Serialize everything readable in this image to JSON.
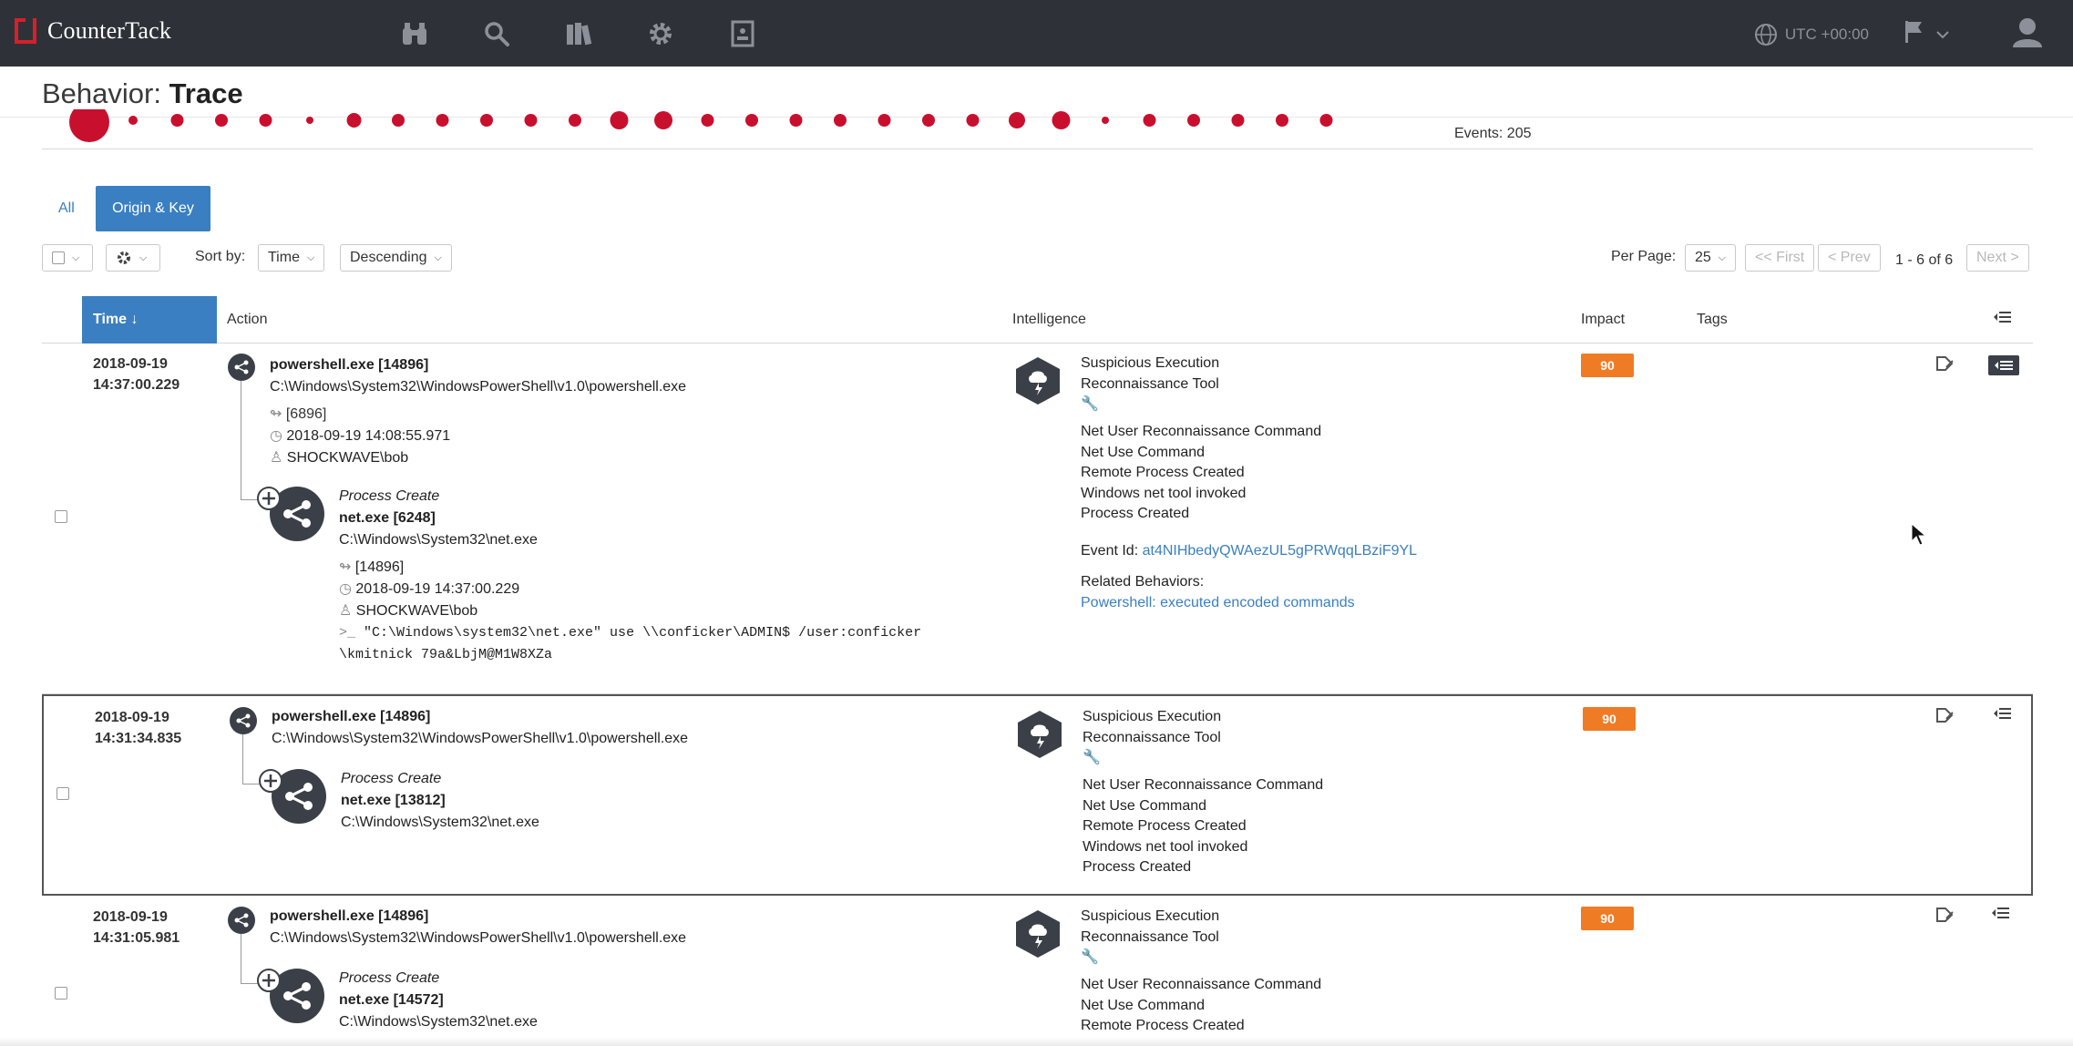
{
  "app": {
    "brand": "CounterTack"
  },
  "nav": {
    "icons": [
      "binoculars-icon",
      "search-icon",
      "books-icon",
      "gear-icon",
      "document-icon"
    ],
    "timezone": "UTC +00:00"
  },
  "page": {
    "title_prefix": "Behavior: ",
    "title_main": "Trace",
    "events_label": "Events: 205"
  },
  "tabs": {
    "all": "All",
    "origin_key": "Origin & Key"
  },
  "toolbar": {
    "sort_by_label": "Sort by:",
    "sort_field": "Time",
    "sort_order": "Descending",
    "per_page_label": "Per Page:",
    "per_page": "25",
    "first": "<< First",
    "prev": "< Prev",
    "range": "1 - 6 of 6",
    "next": "Next >"
  },
  "table": {
    "headers": {
      "time": "Time",
      "action": "Action",
      "intelligence": "Intelligence",
      "impact": "Impact",
      "tags": "Tags"
    },
    "rows": [
      {
        "date": "2018-09-19",
        "time": "14:37:00.229",
        "parent": "powershell.exe [14896]",
        "parent_path": "C:\\Windows\\System32\\WindowsPowerShell\\v1.0\\powershell.exe",
        "parent_pid": "[6896]",
        "parent_time": "2018-09-19 14:08:55.971",
        "parent_user": "SHOCKWAVE\\bob",
        "event_type": "Process Create",
        "child": "net.exe [6248]",
        "child_path": "C:\\Windows\\System32\\net.exe",
        "child_pid": "[14896]",
        "child_time": "2018-09-19 14:37:00.229",
        "child_user": "SHOCKWAVE\\bob",
        "cmd_line1": "\"C:\\Windows\\system32\\net.exe\" use \\\\conficker\\ADMIN$ /user:conficker",
        "cmd_line2": "\\kmitnick 79a&LbjM@M1W8XZa",
        "intel_title1": "Suspicious Execution",
        "intel_title2": "Reconnaissance Tool",
        "intel_items": [
          "Net User Reconnaissance Command",
          "Net Use Command",
          "Remote Process Created",
          "Windows net tool invoked",
          "Process Created"
        ],
        "event_id_label": "Event Id:",
        "event_id": "at4NIHbedyQWAezUL5gPRWqqLBziF9YL",
        "related_label": "Related Behaviors:",
        "related": "Powershell: executed encoded commands",
        "impact": "90"
      },
      {
        "date": "2018-09-19",
        "time": "14:31:34.835",
        "parent": "powershell.exe [14896]",
        "parent_path": "C:\\Windows\\System32\\WindowsPowerShell\\v1.0\\powershell.exe",
        "event_type": "Process Create",
        "child": "net.exe [13812]",
        "child_path": "C:\\Windows\\System32\\net.exe",
        "intel_title1": "Suspicious Execution",
        "intel_title2": "Reconnaissance Tool",
        "intel_items": [
          "Net User Reconnaissance Command",
          "Net Use Command",
          "Remote Process Created",
          "Windows net tool invoked",
          "Process Created"
        ],
        "impact": "90"
      },
      {
        "date": "2018-09-19",
        "time": "14:31:05.981",
        "parent": "powershell.exe [14896]",
        "parent_path": "C:\\Windows\\System32\\WindowsPowerShell\\v1.0\\powershell.exe",
        "event_type": "Process Create",
        "child": "net.exe [14572]",
        "child_path": "C:\\Windows\\System32\\net.exe",
        "intel_title1": "Suspicious Execution",
        "intel_title2": "Reconnaissance Tool",
        "intel_items": [
          "Net User Reconnaissance Command",
          "Net Use Command",
          "Remote Process Created"
        ],
        "impact": "90"
      }
    ]
  },
  "colors": {
    "nav_bg": "#2e3238",
    "accent": "#3a7fc1",
    "impact": "#f07b25",
    "timeline_dot": "#c8102e"
  }
}
